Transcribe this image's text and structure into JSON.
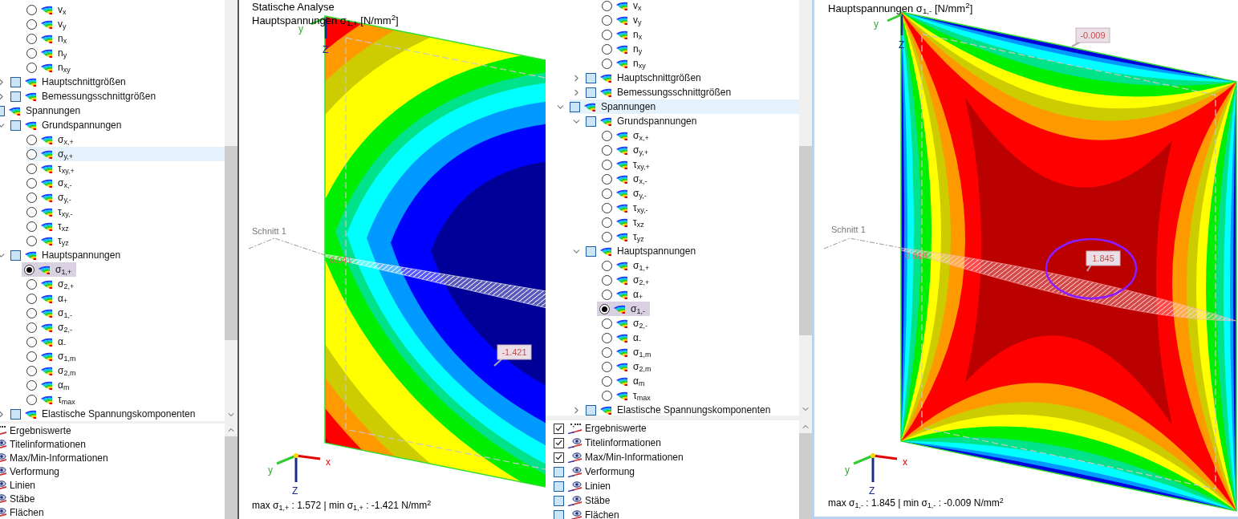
{
  "panels": [
    {
      "navigator": {
        "tree": [
          {
            "children": [
              {
                "children": [
                  {
                    "label": "v$_{x}$",
                    "kind": "radio",
                    "selected": false,
                    "highlighted": false
                  },
                  {
                    "label": "v$_{y}$",
                    "kind": "radio",
                    "selected": false,
                    "highlighted": false
                  },
                  {
                    "label": "n$_{x}$",
                    "kind": "radio",
                    "selected": false,
                    "highlighted": false
                  },
                  {
                    "label": "n$_{y}$",
                    "kind": "radio",
                    "selected": false,
                    "highlighted": false
                  },
                  {
                    "label": "n$_{xy}$",
                    "kind": "radio",
                    "selected": false,
                    "highlighted": false
                  }
                ]
              },
              {
                "label": "Hauptschnittgrößen",
                "kind": "group",
                "expanded": false,
                "highlighted": false
              },
              {
                "label": "Bemessungsschnittgrößen",
                "kind": "group",
                "expanded": false,
                "highlighted": false
              }
            ]
          },
          {
            "label": "Spannungen",
            "kind": "group",
            "expanded": true,
            "highlighted": false,
            "children": [
              {
                "label": "Grundspannungen",
                "kind": "group",
                "expanded": true,
                "highlighted": false,
                "children": [
                  {
                    "label": "σ$_{x,+}$",
                    "kind": "radio",
                    "selected": false,
                    "highlighted": false
                  },
                  {
                    "label": "σ$_{y,+}$",
                    "kind": "radio",
                    "selected": false,
                    "highlighted": true
                  },
                  {
                    "label": "τ$_{xy,+}$",
                    "kind": "radio",
                    "selected": false,
                    "highlighted": false
                  },
                  {
                    "label": "σ$_{x,-}$",
                    "kind": "radio",
                    "selected": false,
                    "highlighted": false
                  },
                  {
                    "label": "σ$_{y,-}$",
                    "kind": "radio",
                    "selected": false,
                    "highlighted": false
                  },
                  {
                    "label": "τ$_{xy,-}$",
                    "kind": "radio",
                    "selected": false,
                    "highlighted": false
                  },
                  {
                    "label": "τ$_{xz}$",
                    "kind": "radio",
                    "selected": false,
                    "highlighted": false
                  },
                  {
                    "label": "τ$_{yz}$",
                    "kind": "radio",
                    "selected": false,
                    "highlighted": false
                  }
                ]
              },
              {
                "label": "Hauptspannungen",
                "kind": "group",
                "expanded": true,
                "highlighted": false,
                "children": [
                  {
                    "label": "σ$_{1,+}$",
                    "kind": "radio",
                    "selected": true,
                    "highlighted": false
                  },
                  {
                    "label": "σ$_{2,+}$",
                    "kind": "radio",
                    "selected": false,
                    "highlighted": false
                  },
                  {
                    "label": "α$_{+}$",
                    "kind": "radio",
                    "selected": false,
                    "highlighted": false
                  },
                  {
                    "label": "σ$_{1,-}$",
                    "kind": "radio",
                    "selected": false,
                    "highlighted": false
                  },
                  {
                    "label": "σ$_{2,-}$",
                    "kind": "radio",
                    "selected": false,
                    "highlighted": false
                  },
                  {
                    "label": "α$_{-}$",
                    "kind": "radio",
                    "selected": false,
                    "highlighted": false
                  },
                  {
                    "label": "σ$_{1,m}$",
                    "kind": "radio",
                    "selected": false,
                    "highlighted": false
                  },
                  {
                    "label": "σ$_{2,m}$",
                    "kind": "radio",
                    "selected": false,
                    "highlighted": false
                  },
                  {
                    "label": "α$_{m}$",
                    "kind": "radio",
                    "selected": false,
                    "highlighted": false
                  },
                  {
                    "label": "τ$_{max}$",
                    "kind": "radio",
                    "selected": false,
                    "highlighted": false
                  }
                ]
              },
              {
                "label": "Elastische Spannungskomponenten",
                "kind": "group",
                "expanded": false,
                "highlighted": false
              }
            ]
          }
        ],
        "display": [
          {
            "label": "Ergebniswerte",
            "kind": "values"
          },
          {
            "label": "Titelinformationen",
            "kind": "view"
          },
          {
            "label": "Max/Min-Informationen",
            "kind": "view"
          },
          {
            "label": "Verformung",
            "kind": "view"
          },
          {
            "label": "Linien",
            "kind": "view"
          },
          {
            "label": "Stäbe",
            "kind": "view"
          },
          {
            "label": "Flächen",
            "kind": "view"
          }
        ]
      },
      "view": {
        "title_lines": [
          "Statische Analyse",
          "Hauptspannungen σ$_{1,+}$ [N/mm$^{2}$]"
        ],
        "section_label": "Schnitt 1",
        "values": [
          {
            "text": "0.041",
            "kind": "edge"
          },
          {
            "text": "-1.421",
            "kind": "callout",
            "circled": false
          }
        ],
        "axis_labels": [
          "y",
          "x",
          "Z",
          "y",
          "Z"
        ],
        "footer": "max σ$_{1,+}$ : 1.572 | min σ$_{1,+}$ : -1.421 N/mm$^{2}$"
      }
    },
    {
      "navigator": {
        "tree": [
          {
            "children": [
              {
                "children": [
                  {
                    "label": "v$_{x}$",
                    "kind": "radio",
                    "selected": false,
                    "highlighted": false
                  },
                  {
                    "label": "v$_{y}$",
                    "kind": "radio",
                    "selected": false,
                    "highlighted": false
                  },
                  {
                    "label": "n$_{x}$",
                    "kind": "radio",
                    "selected": false,
                    "highlighted": false
                  },
                  {
                    "label": "n$_{y}$",
                    "kind": "radio",
                    "selected": false,
                    "highlighted": false
                  },
                  {
                    "label": "n$_{xy}$",
                    "kind": "radio",
                    "selected": false,
                    "highlighted": false
                  }
                ]
              },
              {
                "label": "Hauptschnittgrößen",
                "kind": "group",
                "expanded": false,
                "highlighted": false
              },
              {
                "label": "Bemessungsschnittgrößen",
                "kind": "group",
                "expanded": false,
                "highlighted": false
              }
            ]
          },
          {
            "label": "Spannungen",
            "kind": "group",
            "expanded": true,
            "highlighted": true,
            "children": [
              {
                "label": "Grundspannungen",
                "kind": "group",
                "expanded": true,
                "highlighted": false,
                "children": [
                  {
                    "label": "σ$_{x,+}$",
                    "kind": "radio",
                    "selected": false,
                    "highlighted": false
                  },
                  {
                    "label": "σ$_{y,+}$",
                    "kind": "radio",
                    "selected": false,
                    "highlighted": false
                  },
                  {
                    "label": "τ$_{xy,+}$",
                    "kind": "radio",
                    "selected": false,
                    "highlighted": false
                  },
                  {
                    "label": "σ$_{x,-}$",
                    "kind": "radio",
                    "selected": false,
                    "highlighted": false
                  },
                  {
                    "label": "σ$_{y,-}$",
                    "kind": "radio",
                    "selected": false,
                    "highlighted": false
                  },
                  {
                    "label": "τ$_{xy,-}$",
                    "kind": "radio",
                    "selected": false,
                    "highlighted": false
                  },
                  {
                    "label": "τ$_{xz}$",
                    "kind": "radio",
                    "selected": false,
                    "highlighted": false
                  },
                  {
                    "label": "τ$_{yz}$",
                    "kind": "radio",
                    "selected": false,
                    "highlighted": false
                  }
                ]
              },
              {
                "label": "Hauptspannungen",
                "kind": "group",
                "expanded": true,
                "highlighted": false,
                "children": [
                  {
                    "label": "σ$_{1,+}$",
                    "kind": "radio",
                    "selected": false,
                    "highlighted": false
                  },
                  {
                    "label": "σ$_{2,+}$",
                    "kind": "radio",
                    "selected": false,
                    "highlighted": false
                  },
                  {
                    "label": "α$_{+}$",
                    "kind": "radio",
                    "selected": false,
                    "highlighted": false
                  },
                  {
                    "label": "σ$_{1,-}$",
                    "kind": "radio",
                    "selected": true,
                    "highlighted": false
                  },
                  {
                    "label": "σ$_{2,-}$",
                    "kind": "radio",
                    "selected": false,
                    "highlighted": false
                  },
                  {
                    "label": "α$_{-}$",
                    "kind": "radio",
                    "selected": false,
                    "highlighted": false
                  },
                  {
                    "label": "σ$_{1,m}$",
                    "kind": "radio",
                    "selected": false,
                    "highlighted": false
                  },
                  {
                    "label": "σ$_{2,m}$",
                    "kind": "radio",
                    "selected": false,
                    "highlighted": false
                  },
                  {
                    "label": "α$_{m}$",
                    "kind": "radio",
                    "selected": false,
                    "highlighted": false
                  },
                  {
                    "label": "τ$_{max}$",
                    "kind": "radio",
                    "selected": false,
                    "highlighted": false
                  }
                ]
              },
              {
                "label": "Elastische Spannungskomponenten",
                "kind": "group",
                "expanded": false,
                "highlighted": false
              }
            ]
          }
        ],
        "display": [
          {
            "label": "Ergebniswerte",
            "kind": "values",
            "checked": true
          },
          {
            "label": "Titelinformationen",
            "kind": "view",
            "checked": true
          },
          {
            "label": "Max/Min-Informationen",
            "kind": "view",
            "checked": true
          },
          {
            "label": "Verformung",
            "kind": "view",
            "checked": false
          },
          {
            "label": "Linien",
            "kind": "view",
            "checked": false
          },
          {
            "label": "Stäbe",
            "kind": "view",
            "checked": false
          },
          {
            "label": "Flächen",
            "kind": "view",
            "checked": false
          }
        ]
      },
      "view": {
        "title_lines": [
          "Hauptspannungen σ$_{1,-}$ [N/mm$^{2}$]"
        ],
        "section_label": "Schnitt 1",
        "values": [
          {
            "text": "-0.009",
            "kind": "callout",
            "circled": false
          },
          {
            "text": "0.019",
            "kind": "edge"
          },
          {
            "text": "1.845",
            "kind": "callout",
            "circled": true
          }
        ],
        "axis_labels": [
          "y",
          "x",
          "Z",
          "y",
          "Z"
        ],
        "footer": "max σ$_{1,-}$ : 1.845 | min σ$_{1,-}$ : -0.009 N/mm$^{2}$"
      }
    }
  ]
}
